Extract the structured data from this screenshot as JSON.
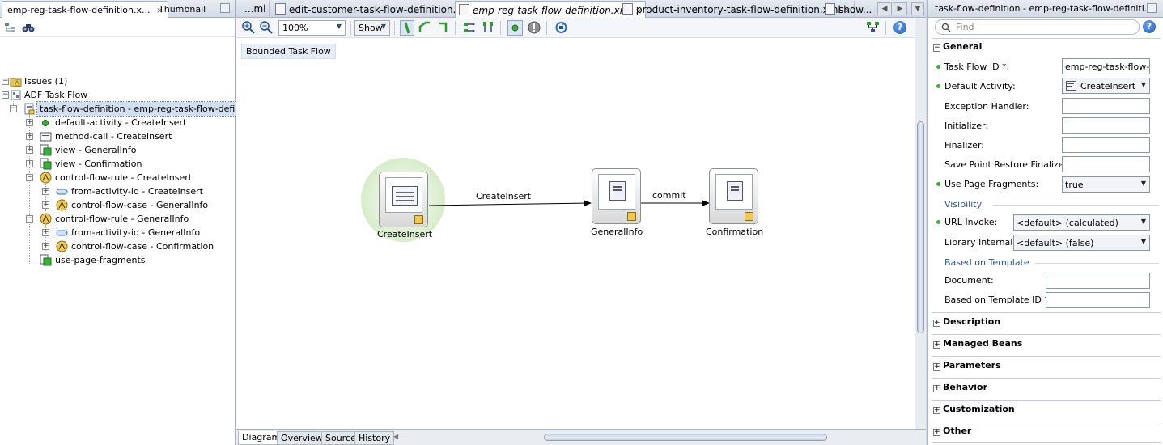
{
  "left": {
    "tabs": [
      {
        "label": "emp-reg-task-flow-definition.x..."
      },
      {
        "label": "Thumbnail"
      }
    ],
    "close_glyph": "×",
    "tree": [
      {
        "label": "Issues (1)",
        "icon": "folder-warning-icon"
      },
      {
        "label": "ADF Task Flow",
        "icon": "task-flow-icon"
      },
      {
        "label": "task-flow-definition - emp-reg-task-flow-definition",
        "icon": "task-flow-definition-icon"
      },
      {
        "label": "default-activity - CreateInsert",
        "icon": "green-dot-icon"
      },
      {
        "label": "method-call - CreateInsert",
        "icon": "method-call-icon"
      },
      {
        "label": "view - GeneralInfo",
        "icon": "view-icon"
      },
      {
        "label": "view - Confirmation",
        "icon": "view-icon"
      },
      {
        "label": "control-flow-rule - CreateInsert",
        "icon": "control-flow-rule-icon"
      },
      {
        "label": "from-activity-id - CreateInsert",
        "icon": "from-activity-icon"
      },
      {
        "label": "control-flow-case - GeneralInfo",
        "icon": "control-flow-case-icon"
      },
      {
        "label": "control-flow-rule - GeneralInfo",
        "icon": "control-flow-rule-icon"
      },
      {
        "label": "from-activity-id - GeneralInfo",
        "icon": "from-activity-icon"
      },
      {
        "label": "control-flow-case - Confirmation",
        "icon": "control-flow-case-icon"
      },
      {
        "label": "use-page-fragments",
        "icon": "use-page-fragments-icon"
      }
    ]
  },
  "center": {
    "tabs": [
      {
        "label": "...ml"
      },
      {
        "label": "edit-customer-task-flow-definition.xml"
      },
      {
        "label": "emp-reg-task-flow-definition.xml"
      },
      {
        "label": "product-inventory-task-flow-definition.xml"
      },
      {
        "label": "show..."
      }
    ],
    "toolbar": {
      "zoom": "100%",
      "show_label": "Show"
    },
    "canvas": {
      "bounded_label": "Bounded Task Flow",
      "nodes": [
        {
          "label": "CreateInsert"
        },
        {
          "label": "GeneralInfo"
        },
        {
          "label": "Confirmation"
        }
      ],
      "edges": [
        {
          "label": "CreateInsert"
        },
        {
          "label": "commit"
        }
      ]
    },
    "bottom_tabs": [
      {
        "label": "Diagram"
      },
      {
        "label": "Overview"
      },
      {
        "label": "Source"
      },
      {
        "label": "History"
      }
    ]
  },
  "right": {
    "title": "task-flow-definition - emp-reg-task-flow-definiti...",
    "find_placeholder": "Find",
    "help_glyph": "?",
    "general_header": "General",
    "props": [
      {
        "label": "Task Flow ID *:",
        "value": "emp-reg-task-flow-..."
      },
      {
        "label": "Default Activity:",
        "value": "CreateInsert"
      },
      {
        "label": "Exception Handler:",
        "value": ""
      },
      {
        "label": "Initializer:",
        "value": ""
      },
      {
        "label": "Finalizer:",
        "value": ""
      },
      {
        "label": "Save Point Restore Finalizer:",
        "value": ""
      },
      {
        "label": "Use Page Fragments:",
        "value": "true"
      }
    ],
    "visibility": {
      "header": "Visibility",
      "url_invoke_label": "URL Invoke:",
      "url_invoke_value": "<default> (calculated)",
      "library_label": "Library Internal:",
      "library_value": "<default> (false)"
    },
    "template": {
      "header": "Based on Template",
      "document_label": "Document:",
      "document_value": "",
      "id_label": "Based on Template ID *:",
      "id_value": ""
    },
    "sections": [
      {
        "label": "Description"
      },
      {
        "label": "Managed Beans"
      },
      {
        "label": "Parameters"
      },
      {
        "label": "Behavior"
      },
      {
        "label": "Customization"
      },
      {
        "label": "Other"
      }
    ]
  },
  "colors": {
    "accent_green": "#3cad3c",
    "selection_blue": "#d2dff2",
    "halo_green": "#c8e5b6"
  }
}
